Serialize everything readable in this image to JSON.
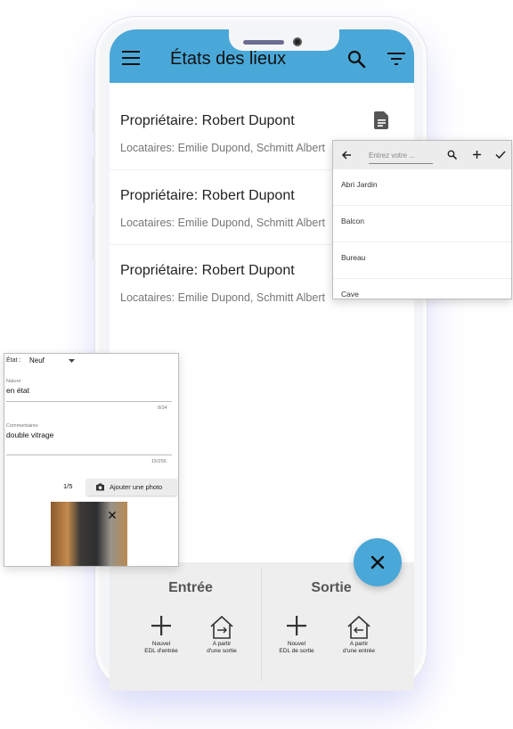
{
  "app": {
    "title": "États des lieux",
    "accent_color": "#4aa8d8"
  },
  "list": [
    {
      "owner": "Propriétaire: Robert Dupont",
      "tenants": "Locataires: Emilie Dupond, Schmitt Albert",
      "icon": "document-icon"
    },
    {
      "owner": "Propriétaire: Robert Dupont",
      "tenants": "Locataires: Emilie Dupond, Schmitt Albert"
    },
    {
      "owner": "Propriétaire: Robert Dupont",
      "tenants": "Locataires: Emilie Dupond, Schmitt Albert"
    }
  ],
  "bottom": {
    "entree": {
      "title": "Entrée",
      "new_label_1": "Nouvel",
      "new_label_2": "EDL d'entrée",
      "from_label_1": "A partir",
      "from_label_2": "d'une sortie"
    },
    "sortie": {
      "title": "Sortie",
      "new_label_1": "Nouvel",
      "new_label_2": "EDL de sortie",
      "from_label_1": "A partir",
      "from_label_2": "d'une entrée"
    }
  },
  "picker": {
    "placeholder": "Entrez votre ...",
    "items": [
      "Abri Jardin",
      "Balcon",
      "Bureau",
      "Cave"
    ]
  },
  "form": {
    "etat_label": "État :",
    "etat_value": "Neuf",
    "nature_label": "Nature",
    "nature_value": "en état",
    "nature_count": "8/24",
    "comments_label": "Commentaires",
    "comments_value": "double vitrage",
    "comments_count": "15/256",
    "photo_count": "1/5",
    "add_photo_label": "Ajouter une photo"
  }
}
